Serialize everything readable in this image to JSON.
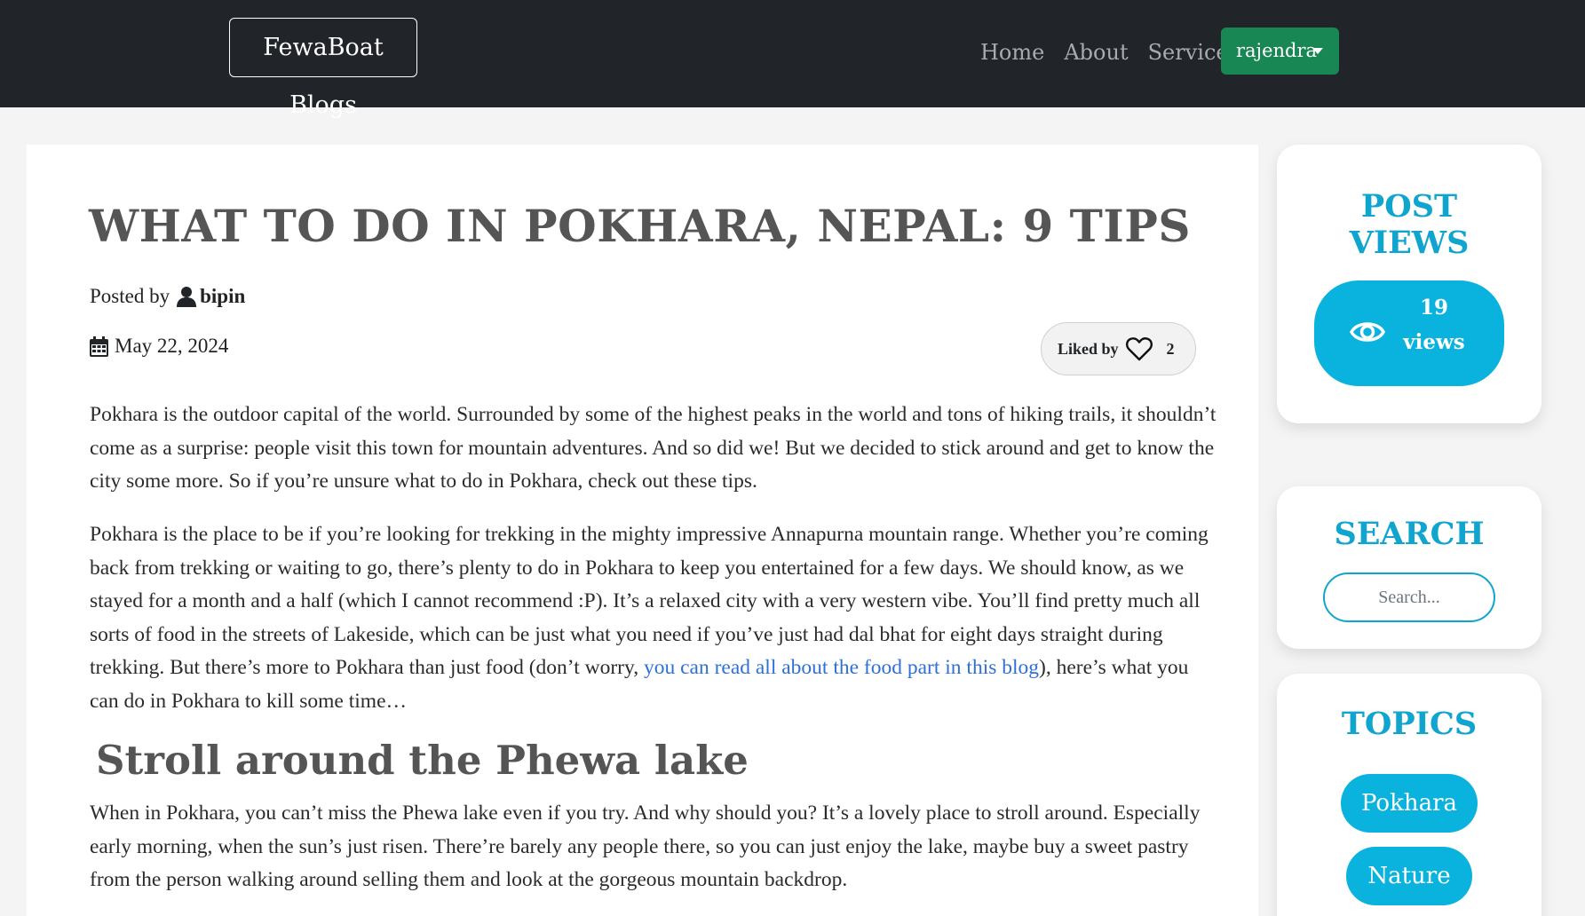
{
  "navbar": {
    "brand": "FewaBoat Blogs",
    "links": [
      "Home",
      "About",
      "Services"
    ],
    "user_button": "rajendra",
    "bg_color": "#212529",
    "user_button_color": "#198754"
  },
  "post": {
    "title": "WHAT TO DO IN POKHARA, NEPAL: 9 TIPS",
    "posted_by_label": "Posted by",
    "author": "bipin",
    "date": "May 22, 2024",
    "liked_by_label": "Liked by",
    "like_count": "2",
    "paragraph_1": "Pokhara is the outdoor capital of the world. Surrounded by some of the highest peaks in the world and tons of hiking trails, it shouldn’t come as a surprise: people visit this town for mountain adventures. And so did we! But we decided to stick around and get to know the city some more. So if you’re unsure what to do in Pokhara, check out these tips.",
    "paragraph_2_before": "Pokhara is the place to be if you’re looking for trekking in the mighty impressive Annapurna mountain range. Whether you’re coming back from trekking or waiting to go, there’s plenty to do in Pokhara to keep you entertained for a few days. We should know, as we stayed for a month and a half (which I cannot recommend :P). It’s a relaxed city with a very western vibe. You’ll find pretty much all sorts of food in the streets of Lakeside, which can be just what you need if you’ve just had dal bhat for eight days straight during trekking. But there’s more to Pokhara than just food (don’t worry, ",
    "paragraph_2_link": "you can read all about the food part in this blog",
    "paragraph_2_after": "), here’s what you can do in Pokhara to kill some time…",
    "section_heading": "Stroll around the Phewa lake",
    "paragraph_3": "When in Pokhara, you can’t miss the Phewa lake even if you try. And why should you? It’s a lovely place to stroll around. Especially early morning, when the sun’s just risen. There’re barely any people there, so you can just enjoy the lake, maybe buy a sweet pastry from the person walking around selling them and look at the gorgeous mountain backdrop."
  },
  "sidebar": {
    "views_title_line1": "POST",
    "views_title_line2": "VIEWS",
    "views_count": "19",
    "views_label": "views",
    "search_title": "SEARCH",
    "search_placeholder": "Search...",
    "topics_title": "TOPICS",
    "topics": [
      "Pokhara",
      "Nature"
    ],
    "accent_color": "#0ab2de"
  },
  "icons": [
    "user-icon",
    "calendar-icon",
    "heart-icon",
    "eye-icon",
    "caret-down-icon"
  ]
}
